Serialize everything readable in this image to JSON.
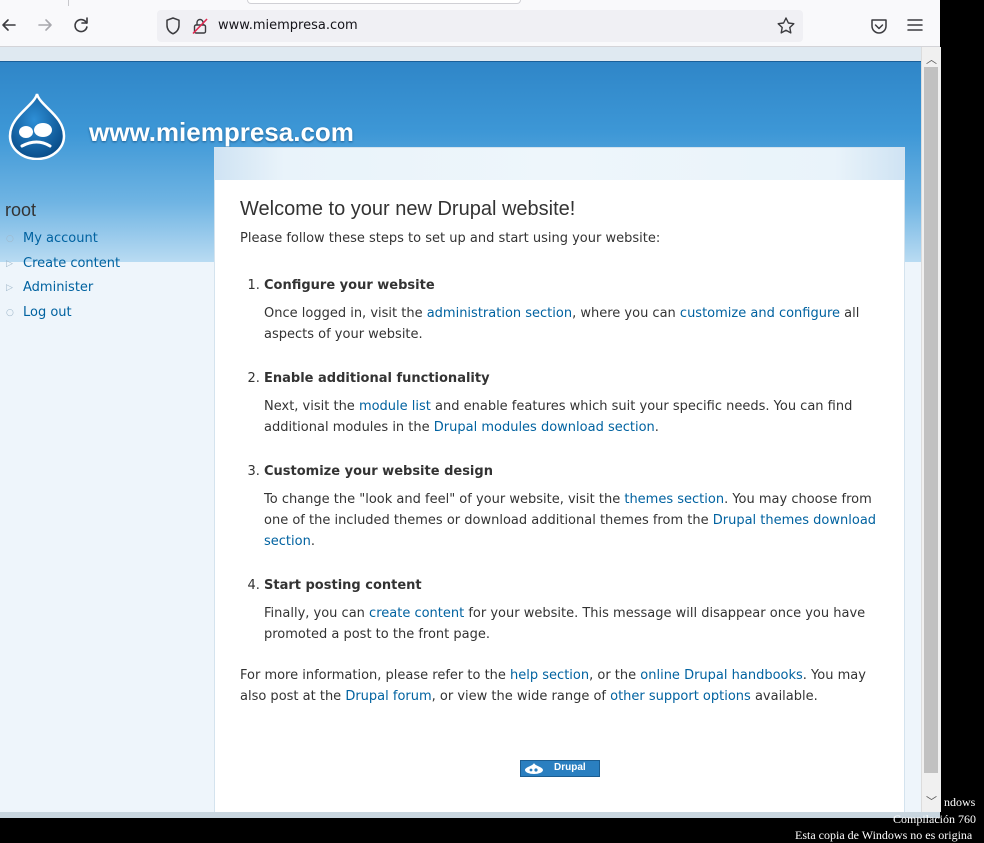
{
  "browser": {
    "url": "www.miempresa.com",
    "icons": [
      "back-icon",
      "forward-icon",
      "reload-icon",
      "shield-icon",
      "insecure-lock-icon",
      "bookmark-star-icon",
      "pocket-icon",
      "menu-icon"
    ]
  },
  "site": {
    "name": "www.miempresa.com"
  },
  "sidebar": {
    "user": "root",
    "items": [
      {
        "label": "My account"
      },
      {
        "label": "Create content"
      },
      {
        "label": "Administer"
      },
      {
        "label": "Log out"
      }
    ]
  },
  "content": {
    "title": "Welcome to your new Drupal website!",
    "intro": "Please follow these steps to set up and start using your website:",
    "steps": [
      {
        "title": "Configure your website",
        "t1": "Once logged in, visit the ",
        "l1": "administration section",
        "t2": ", where you can ",
        "l2": "customize and configure",
        "t3": " all aspects of your website."
      },
      {
        "title": "Enable additional functionality",
        "t1": "Next, visit the ",
        "l1": "module list",
        "t2": " and enable features which suit your specific needs. You can find additional modules in the ",
        "l2": "Drupal modules download section",
        "t3": "."
      },
      {
        "title": "Customize your website design",
        "t1": "To change the \"look and feel\" of your website, visit the ",
        "l1": "themes section",
        "t2": ". You may choose from one of the included themes or download additional themes from the ",
        "l2": "Drupal themes download section",
        "t3": "."
      },
      {
        "title": "Start posting content",
        "t1": "Finally, you can ",
        "l1": "create content",
        "t2": " for your website. This message will disappear once you have promoted a post to the front page."
      }
    ],
    "more": {
      "t1": "For more information, please refer to the ",
      "l1": "help section",
      "t2": ", or the ",
      "l2": "online Drupal handbooks",
      "t3": ". You may also post at the ",
      "l3": "Drupal forum",
      "t4": ", or view the wide range of ",
      "l4": "other support options",
      "t5": " available."
    },
    "powered_by": "Drupal"
  },
  "watermark": {
    "line1": "ndows",
    "line2": "Compilación  760",
    "line3": "Esta copia de Windows no es origina"
  },
  "colors": {
    "link": "#0062a0",
    "header_blue": "#3d97d6",
    "text": "#333333"
  }
}
